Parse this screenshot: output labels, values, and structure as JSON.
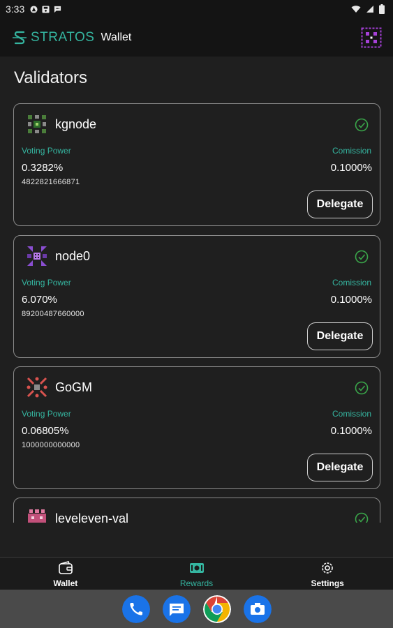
{
  "status_bar": {
    "time": "3:33"
  },
  "header": {
    "brand": "STRATOS",
    "subtitle": "Wallet"
  },
  "page": {
    "title": "Validators"
  },
  "validators": [
    {
      "name": "kgnode",
      "voting_power_label": "Voting Power",
      "voting_power": "0.3282%",
      "tokens": "4822821666871",
      "commission_label": "Comission",
      "commission": "0.1000%",
      "action": "Delegate"
    },
    {
      "name": "node0",
      "voting_power_label": "Voting Power",
      "voting_power": "6.070%",
      "tokens": "89200487660000",
      "commission_label": "Comission",
      "commission": "0.1000%",
      "action": "Delegate"
    },
    {
      "name": "GoGM",
      "voting_power_label": "Voting Power",
      "voting_power": "0.06805%",
      "tokens": "1000000000000",
      "commission_label": "Comission",
      "commission": "0.1000%",
      "action": "Delegate"
    },
    {
      "name": "leveleven-val"
    }
  ],
  "nav": {
    "items": [
      {
        "label": "Wallet",
        "icon": "wallet-icon",
        "active": false
      },
      {
        "label": "Rewards",
        "icon": "rewards-icon",
        "active": true
      },
      {
        "label": "Settings",
        "icon": "gear-icon",
        "active": false
      }
    ]
  },
  "colors": {
    "accent": "#35b5a0",
    "background": "#1f1f1f",
    "header": "#141414",
    "card_border": "#8a8a8a"
  },
  "dock": {
    "apps": [
      "phone-icon",
      "messages-icon",
      "chrome-icon",
      "camera-icon"
    ]
  }
}
